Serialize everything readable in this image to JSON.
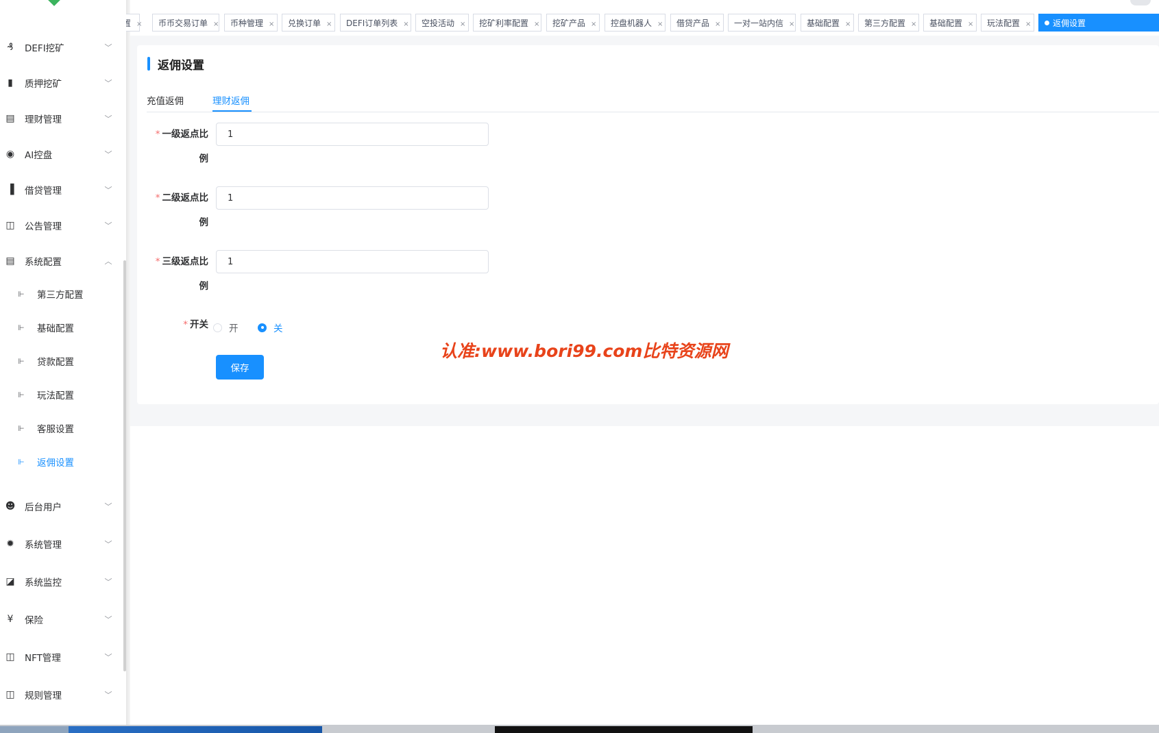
{
  "sidebar": {
    "items": [
      {
        "label": "DEFI挖矿",
        "icon": "coins-icon",
        "glyph": "₰",
        "arrow": "﹀"
      },
      {
        "label": "质押挖矿",
        "icon": "bar-chart-icon",
        "glyph": "▮",
        "arrow": "﹀"
      },
      {
        "label": "理财管理",
        "icon": "document-icon",
        "glyph": "▤",
        "arrow": "﹀"
      },
      {
        "label": "AI控盘",
        "icon": "robot-icon",
        "glyph": "◉",
        "arrow": "﹀"
      },
      {
        "label": "借贷管理",
        "icon": "book-icon",
        "glyph": "▐",
        "arrow": "﹀"
      },
      {
        "label": "公告管理",
        "icon": "open-book-icon",
        "glyph": "◫",
        "arrow": "﹀"
      },
      {
        "label": "系统配置",
        "icon": "document-icon",
        "glyph": "▤",
        "arrow": "︿"
      }
    ],
    "submenu": [
      {
        "label": "第三方配置",
        "icon": "tree-icon",
        "glyph": "⊩"
      },
      {
        "label": "基础配置",
        "icon": "tree-icon",
        "glyph": "⊩"
      },
      {
        "label": "贷款配置",
        "icon": "tree-icon",
        "glyph": "⊩"
      },
      {
        "label": "玩法配置",
        "icon": "tree-icon",
        "glyph": "⊩"
      },
      {
        "label": "客服设置",
        "icon": "tree-icon",
        "glyph": "⊩"
      },
      {
        "label": "返佣设置",
        "icon": "tree-icon",
        "glyph": "⊩"
      }
    ],
    "items_after": [
      {
        "label": "后台用户",
        "icon": "users-icon",
        "glyph": "☻",
        "arrow": "﹀"
      },
      {
        "label": "系统管理",
        "icon": "gear-icon",
        "glyph": "✹",
        "arrow": "﹀"
      },
      {
        "label": "系统监控",
        "icon": "monitor-icon",
        "glyph": "◪",
        "arrow": "﹀"
      },
      {
        "label": "保险",
        "icon": "yen-icon",
        "glyph": "¥",
        "arrow": "﹀"
      },
      {
        "label": "NFT管理",
        "icon": "open-book-icon",
        "glyph": "◫",
        "arrow": "﹀"
      },
      {
        "label": "规则管理",
        "icon": "open-book-icon",
        "glyph": "◫",
        "arrow": "﹀"
      }
    ]
  },
  "tabs": [
    {
      "label": "置",
      "close": "×"
    },
    {
      "label": "币币交易订单",
      "close": "×"
    },
    {
      "label": "币种管理",
      "close": "×"
    },
    {
      "label": "兑换订单",
      "close": "×"
    },
    {
      "label": "DEFI订单列表",
      "close": "×"
    },
    {
      "label": "空投活动",
      "close": "×"
    },
    {
      "label": "挖矿利率配置",
      "close": "×"
    },
    {
      "label": "挖矿产品",
      "close": "×"
    },
    {
      "label": "控盘机器人",
      "close": "×"
    },
    {
      "label": "借贷产品",
      "close": "×"
    },
    {
      "label": "一对一站内信",
      "close": "×"
    },
    {
      "label": "基础配置",
      "close": "×"
    },
    {
      "label": "第三方配置",
      "close": "×"
    },
    {
      "label": "基础配置",
      "close": "×"
    },
    {
      "label": "玩法配置",
      "close": "×"
    },
    {
      "label": "返佣设置",
      "close": ""
    }
  ],
  "page": {
    "title": "返佣设置",
    "inner_tabs": [
      "充值返佣",
      "理财返佣"
    ],
    "active_inner_tab": "理财返佣",
    "required_mark": "*",
    "fields": [
      {
        "label_line1": "一级返点比",
        "label_line2": "例",
        "value": "1"
      },
      {
        "label_line1": "二级返点比",
        "label_line2": "例",
        "value": "1"
      },
      {
        "label_line1": "三级返点比",
        "label_line2": "例",
        "value": "1"
      }
    ],
    "switch": {
      "label": "开关",
      "options": [
        "开",
        "关"
      ],
      "selected": "关"
    },
    "save_label": "保存"
  },
  "watermark": "认准:www.bori99.com比特资源网",
  "colors": {
    "primary": "#1890ff",
    "required": "#f56c6c",
    "watermark": "#e8431a"
  }
}
